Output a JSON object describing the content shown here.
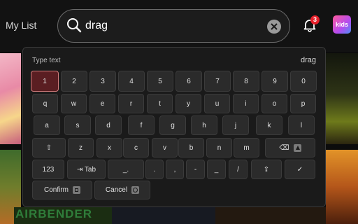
{
  "header": {
    "my_list_label": "My List",
    "search": {
      "query": "drag"
    },
    "notifications_count": "3",
    "kids_label": "kids"
  },
  "posters": {
    "banner_text": "AIRBENDER"
  },
  "keyboard": {
    "label": "Type text",
    "echo_text": "drag",
    "number_row": [
      "1",
      "2",
      "3",
      "4",
      "5",
      "6",
      "7",
      "8",
      "9",
      "0"
    ],
    "row_q": [
      "q",
      "w",
      "e",
      "r",
      "t",
      "y",
      "u",
      "i",
      "o",
      "p"
    ],
    "row_a": [
      "a",
      "s",
      "d",
      "f",
      "g",
      "h",
      "j",
      "k",
      "l"
    ],
    "row_z": [
      "⇧",
      "z",
      "x",
      "c",
      "v",
      "b",
      "n",
      "m",
      "⌫"
    ],
    "row_bottom": [
      "123",
      "⇥ Tab",
      "_.",
      ".",
      " ,",
      "-",
      "_",
      "/",
      "⇪",
      "✓"
    ],
    "confirm_label": "Confirm",
    "cancel_label": "Cancel",
    "selected_key": "1"
  },
  "colors": {
    "selected_key_bg": "#5a1e22",
    "badge": "#e8202a"
  }
}
